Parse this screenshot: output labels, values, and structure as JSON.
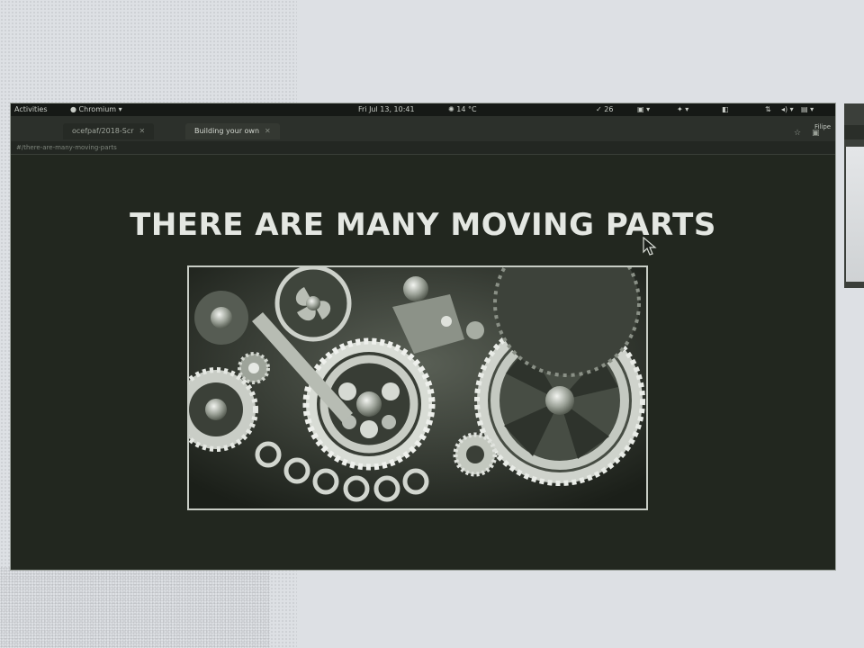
{
  "topbar": {
    "activities": "Activities",
    "app_menu": "Chromium ▾",
    "clock": "Fri Jul 13, 10:41",
    "weather": "14 °C",
    "updates": "26"
  },
  "tabs": [
    {
      "label": "ocefpaf/2018-Scr",
      "active": false
    },
    {
      "label": "Building your own",
      "active": true
    }
  ],
  "address": "#/there-are-many-moving-parts",
  "side_window_label": "Filipe",
  "slide": {
    "title": "THERE ARE MANY MOVING PARTS",
    "image_subject": "gears-photo"
  },
  "colors": {
    "slide_bg": "#22271f",
    "title": "#e4e7e2",
    "page_bg": "#dde0e4"
  }
}
